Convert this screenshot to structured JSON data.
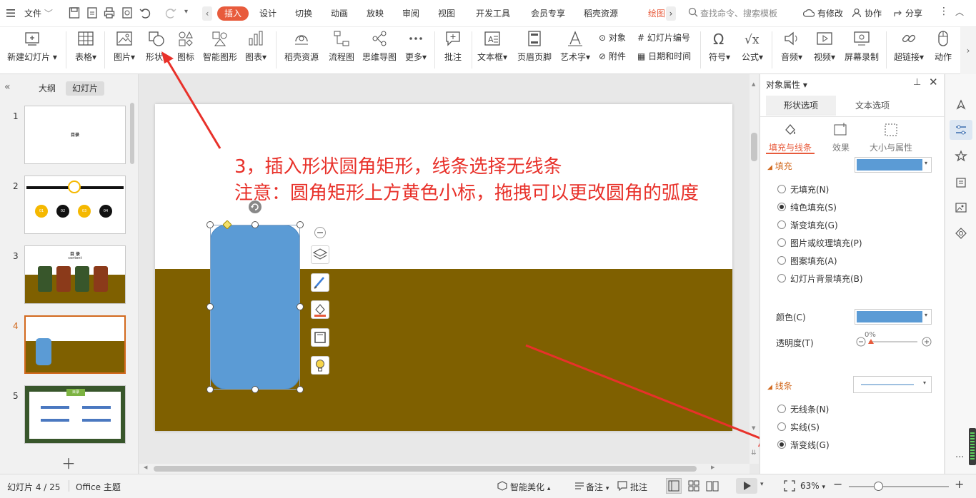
{
  "menubar": {
    "file_label": "文件",
    "tabs": [
      "插入",
      "设计",
      "切换",
      "动画",
      "放映",
      "审阅",
      "视图",
      "开发工具",
      "会员专享",
      "稻壳资源",
      "绘图"
    ],
    "search_placeholder": "查找命令、搜索模板",
    "has_changes": "有修改",
    "collab": "协作",
    "share": "分享"
  },
  "ribbon": {
    "new_slide": "新建幻灯片",
    "table": "表格",
    "picture": "图片",
    "shape": "形状",
    "icon": "图标",
    "smart_shape": "智能图形",
    "chart": "图表",
    "docer_res": "稻壳资源",
    "flowchart": "流程图",
    "mindmap": "思维导图",
    "more": "更多",
    "comment": "批注",
    "textbox": "文本框",
    "header_footer": "页眉页脚",
    "art_text": "艺术字",
    "object": "对象",
    "slide_number": "幻灯片编号",
    "attachment": "附件",
    "datetime": "日期和时间",
    "symbol": "符号",
    "formula": "公式",
    "audio": "音频",
    "video": "视频",
    "screen_record": "屏幕录制",
    "hyperlink": "超链接",
    "action": "动作"
  },
  "left_panel": {
    "outline_tab": "大纲",
    "slides_tab": "幻灯片",
    "slide_numbers": [
      "1",
      "2",
      "3",
      "4",
      "5"
    ],
    "thumb1_text": "目录",
    "thumb2_badges": [
      "01",
      "02",
      "03",
      "04"
    ],
    "thumb3_title": "目 录",
    "thumb3_sub": "content",
    "thumb5_header": "目录"
  },
  "annotation": {
    "line1": "3，插入形状圆角矩形，线条选择无线条",
    "line2": "注意：圆角矩形上方黄色小标，拖拽可以更改圆角的弧度"
  },
  "colors": {
    "accent": "#e85b3c",
    "shape_fill": "#5b9bd5",
    "slide_bottom": "#7f6000",
    "annotation_red": "#e8312a"
  },
  "panel": {
    "title": "对象属性",
    "tab_shape": "形状选项",
    "tab_text": "文本选项",
    "sub_fill_line": "填充与线条",
    "sub_effect": "效果",
    "sub_size": "大小与属性",
    "fill_section": "填充",
    "fill_options": [
      "无填充(N)",
      "纯色填充(S)",
      "渐变填充(G)",
      "图片或纹理填充(P)",
      "图案填充(A)",
      "幻灯片背景填充(B)"
    ],
    "fill_selected": "纯色填充(S)",
    "color_label": "颜色(C)",
    "transparency_label": "透明度(T)",
    "transparency_value": "0%",
    "line_section": "线条",
    "line_options": [
      "无线条(N)",
      "实线(S)",
      "渐变线(G)"
    ],
    "line_selected": "渐变线(G)"
  },
  "statusbar": {
    "slide_info": "幻灯片 4 / 25",
    "theme": "Office 主题",
    "smart_beautify": "智能美化",
    "notes": "备注",
    "comments": "批注",
    "zoom": "63%"
  }
}
